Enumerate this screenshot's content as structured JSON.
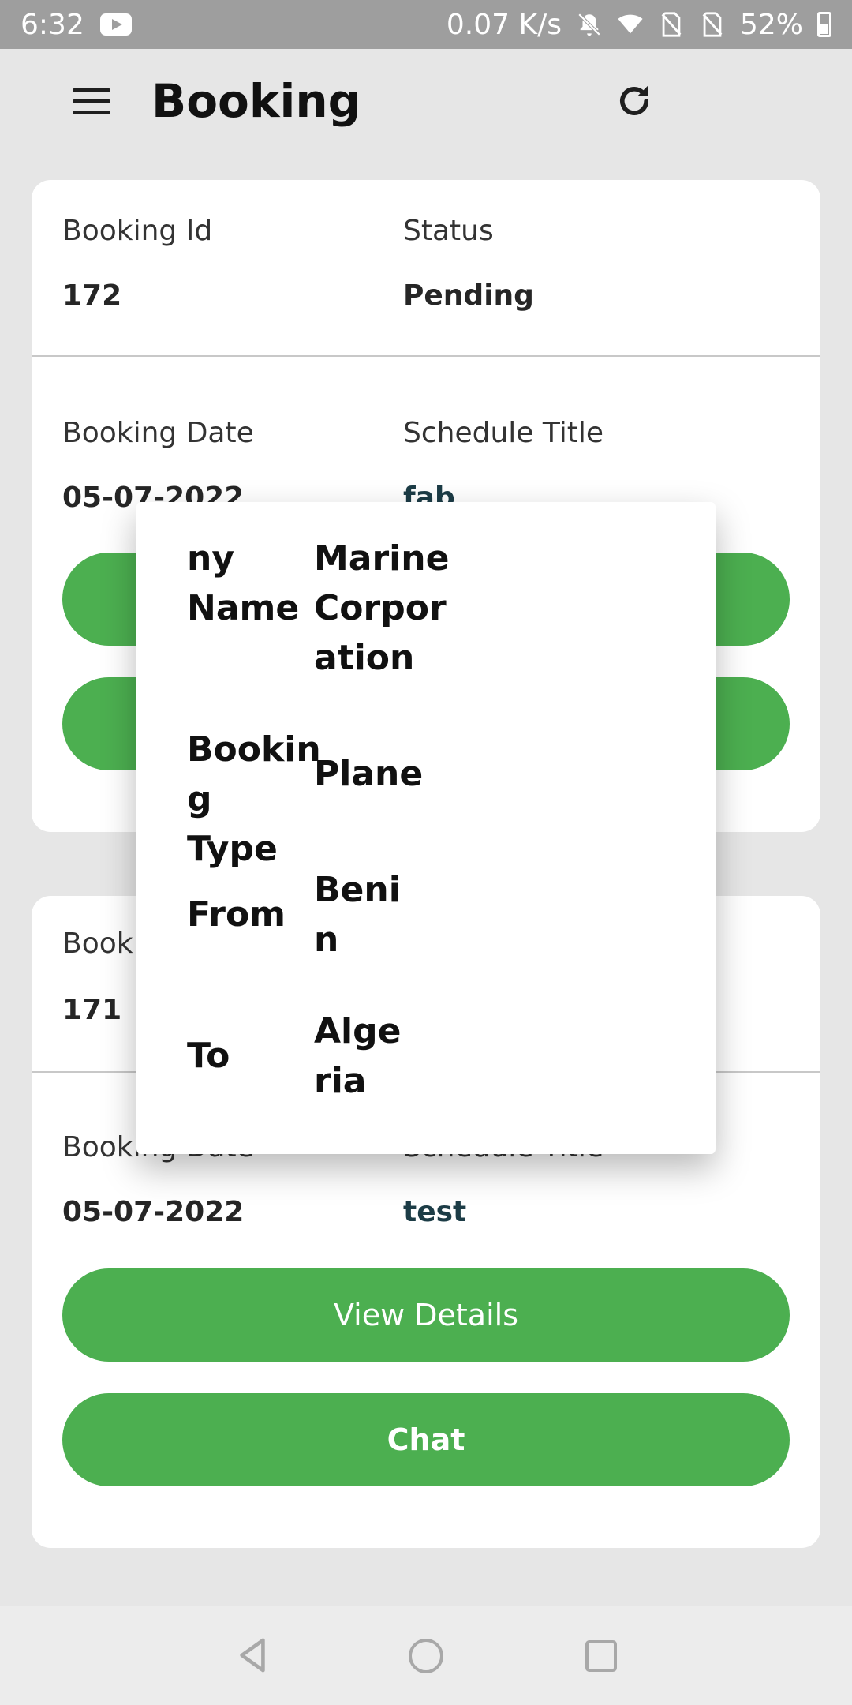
{
  "status_bar": {
    "time": "6:32",
    "network_speed": "0.07 K/s",
    "battery": "52%",
    "icons": [
      "youtube-icon",
      "bell-muted-icon",
      "wifi-icon",
      "no-sim-icon",
      "no-sim-icon",
      "battery-icon"
    ]
  },
  "app_bar": {
    "title": "Booking",
    "menu_icon": "hamburger-menu-icon",
    "refresh_icon": "refresh-icon"
  },
  "bookings": [
    {
      "booking_id_label": "Booking Id",
      "booking_id": "172",
      "status_label": "Status",
      "status": "Pending",
      "booking_date_label": "Booking Date",
      "booking_date": "05-07-2022",
      "schedule_title_label": "Schedule Title",
      "schedule_title": "fab"
    },
    {
      "booking_id_label": "Booki",
      "booking_id": "171",
      "booking_date_label": "Booking Date",
      "booking_date": "05-07-2022",
      "schedule_title_label": "Schedule Title",
      "schedule_title": "test",
      "view_details_label": "View Details",
      "chat_label": "Chat"
    }
  ],
  "popup": {
    "company_label_line1": "ny",
    "company_label_line2": "Name",
    "company_value_line1": "Marine",
    "company_value_line2": "Corpor",
    "company_value_line3": "ation",
    "type_label_line1": "Bookin",
    "type_label_line2": "g Type",
    "type_value": "Plane",
    "from_label": "From",
    "from_value_line1": "Beni",
    "from_value_line2": "n",
    "to_label": "To",
    "to_value_line1": "Alge",
    "to_value_line2": "ria"
  },
  "colors": {
    "accent_green": "#4caf50",
    "background": "#e6e6e6",
    "status_bar": "#9e9e9e",
    "schedule_title": "#1c3c46"
  },
  "nav_bar": {
    "icons": [
      "back-icon",
      "home-icon",
      "recent-apps-icon"
    ]
  }
}
